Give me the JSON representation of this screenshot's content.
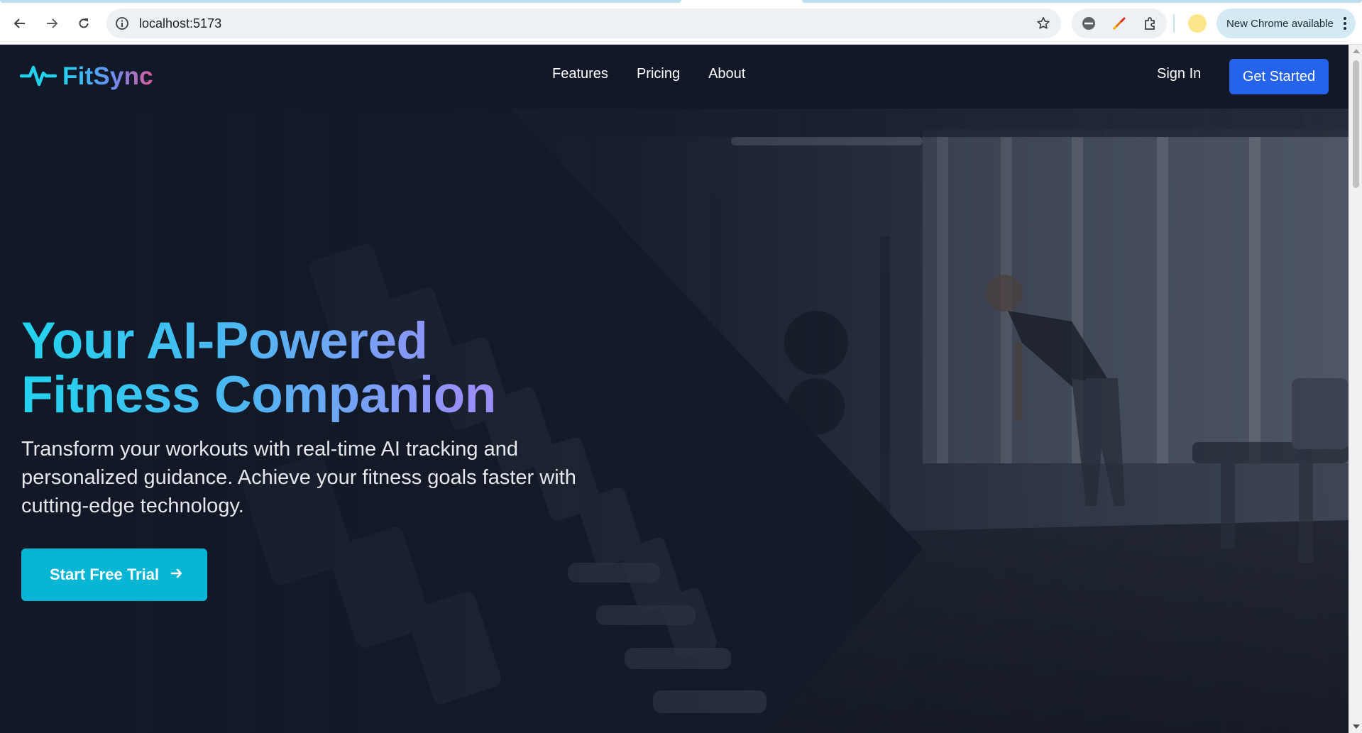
{
  "browser": {
    "url": "localhost:5173",
    "update_label": "New Chrome available",
    "icons": [
      "back-arrow-icon",
      "forward-arrow-icon",
      "reload-icon",
      "site-info-icon",
      "bookmark-star-icon",
      "blocked-extension-icon",
      "color-picker-extension-icon",
      "extensions-puzzle-icon",
      "profile-avatar",
      "more-vertical-icon"
    ]
  },
  "brand": {
    "name": "FitSync",
    "logo_icon": "heartbeat-pulse-icon",
    "gradient": [
      "#22d3ee",
      "#6b8ef7",
      "#e15a9b"
    ]
  },
  "nav": {
    "links": [
      "Features",
      "Pricing",
      "About"
    ],
    "sign_in": "Sign In",
    "get_started": "Get Started"
  },
  "hero": {
    "title_line1": "Your AI-Powered",
    "title_line2": "Fitness Companion",
    "subtitle": "Transform your workouts with real-time AI tracking and personalized guidance. Achieve your fitness goals faster with cutting-edge technology.",
    "cta_label": "Start Free Trial",
    "cta_icon": "arrow-right-icon",
    "background": "dimmed gym photo with dumbbell rack and person exercising"
  },
  "colors": {
    "navbar_bg": "#111827",
    "primary_button": "#2563eb",
    "cta_button": "#06b6d4",
    "title_gradient": [
      "#22d3ee",
      "#a78bfa"
    ]
  }
}
